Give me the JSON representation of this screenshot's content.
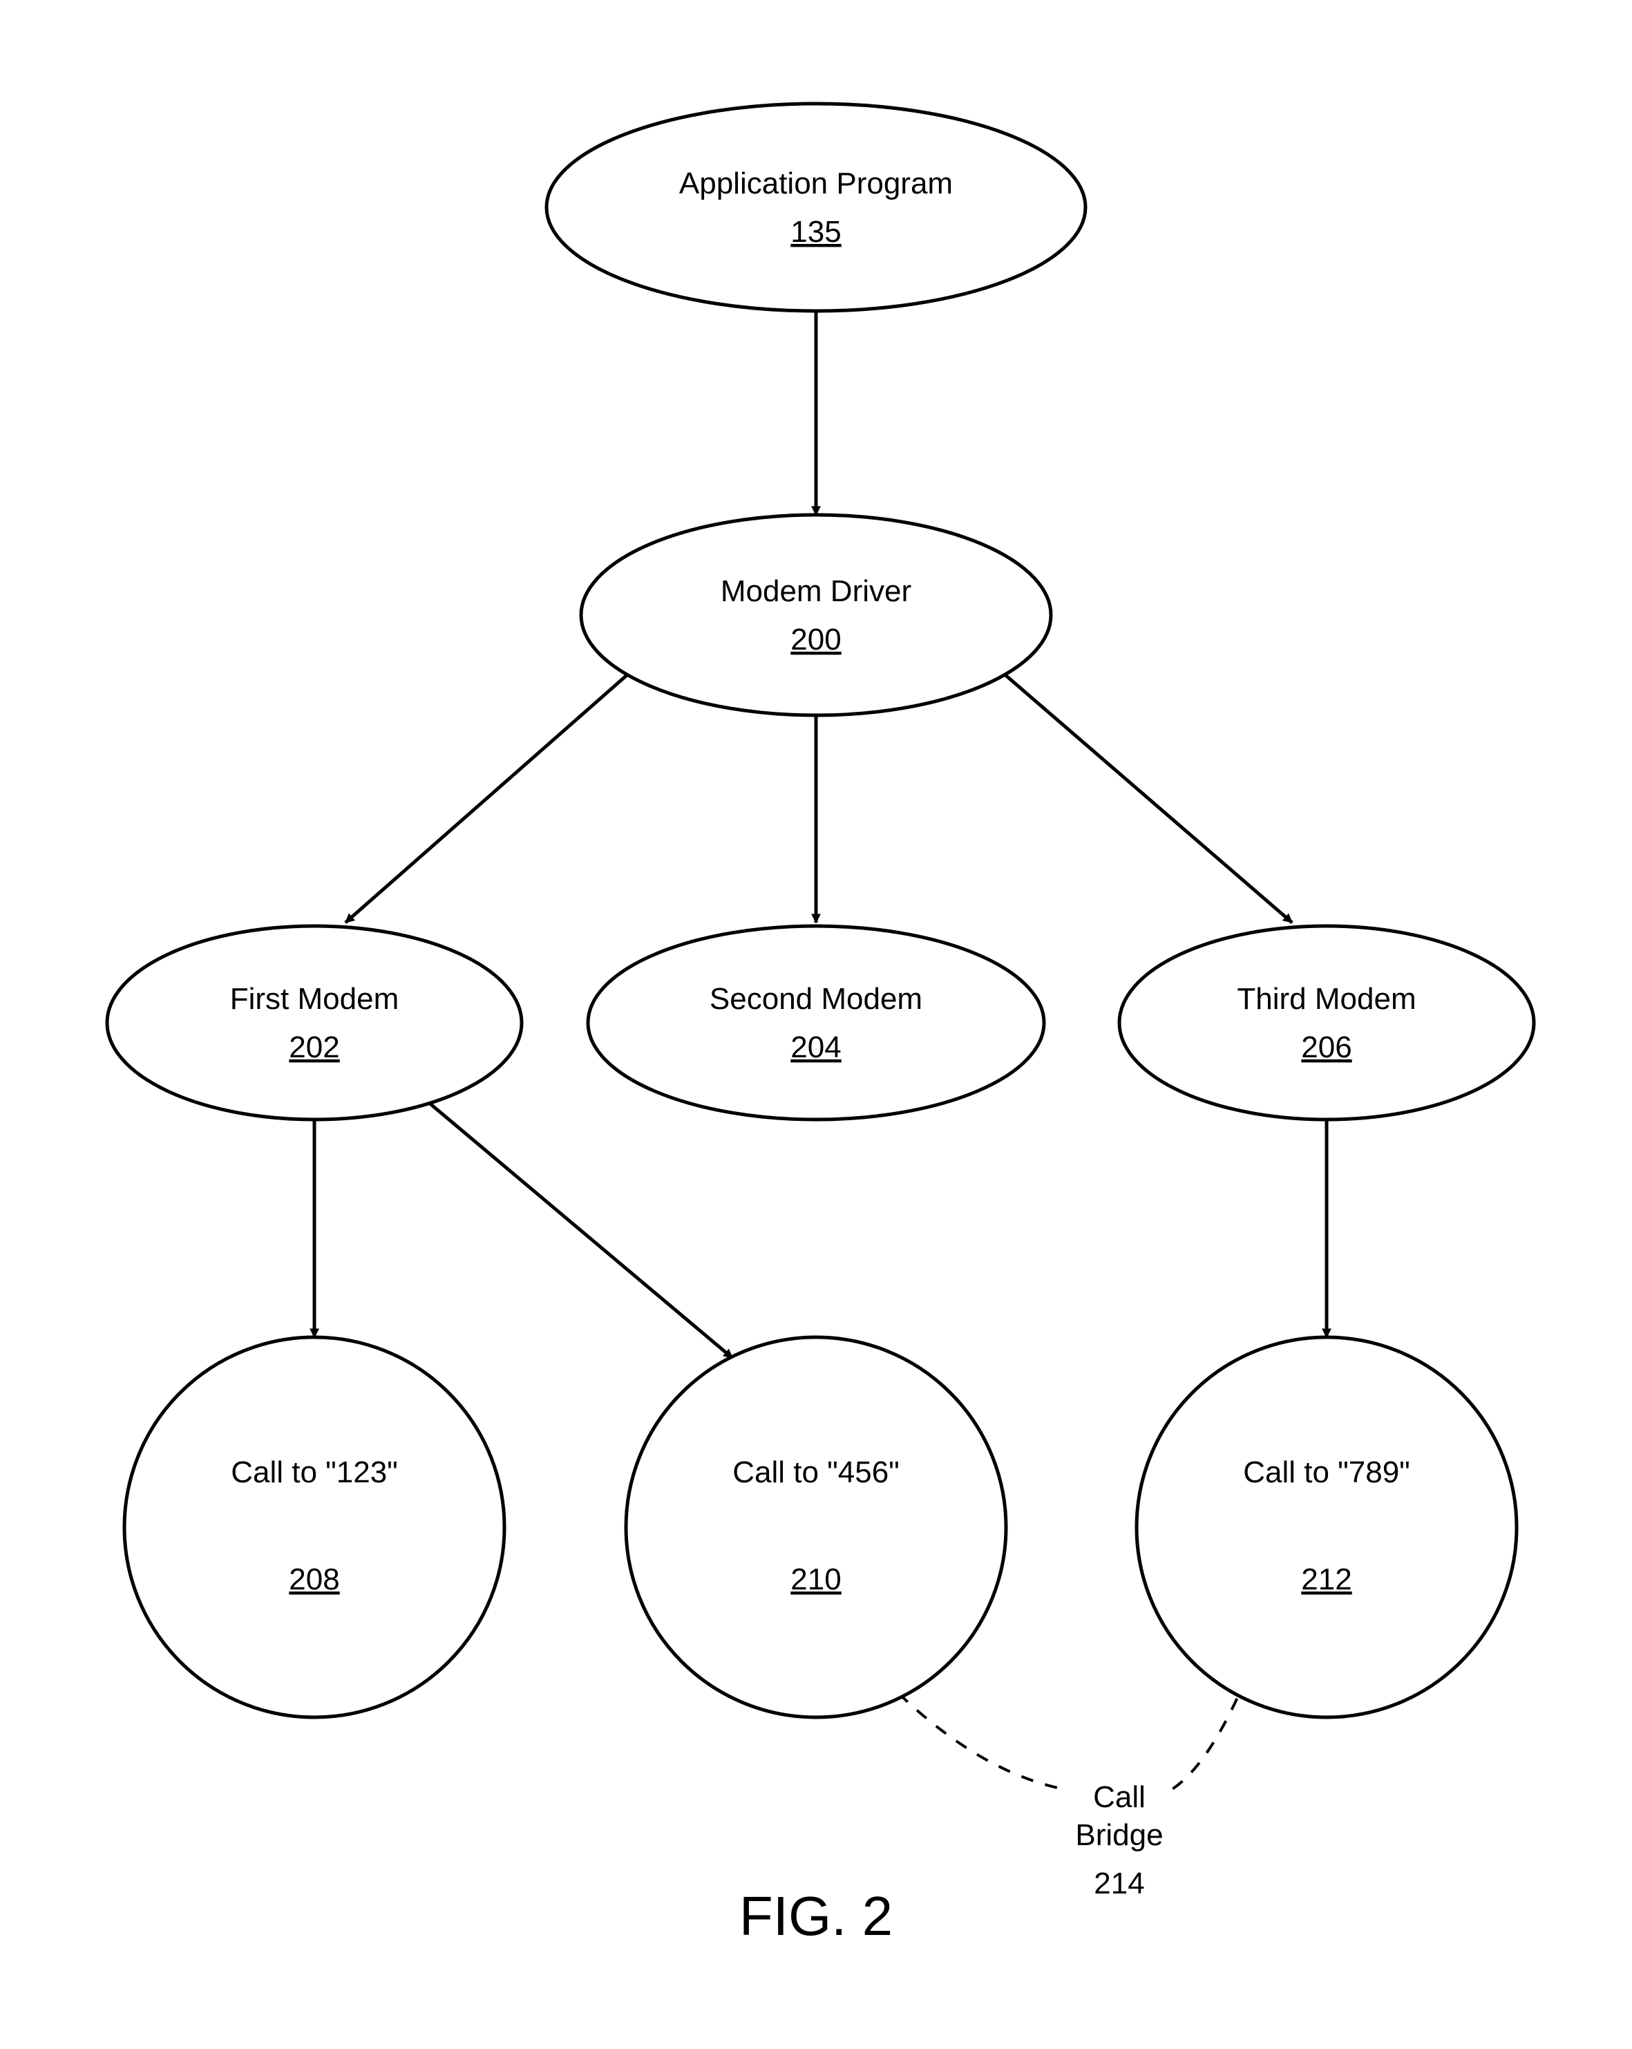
{
  "figure_label": "FIG. 2",
  "nodes": {
    "app": {
      "label": "Application Program",
      "ref": "135"
    },
    "driver": {
      "label": "Modem Driver",
      "ref": "200"
    },
    "modem1": {
      "label": "First Modem",
      "ref": "202"
    },
    "modem2": {
      "label": "Second Modem",
      "ref": "204"
    },
    "modem3": {
      "label": "Third Modem",
      "ref": "206"
    },
    "call123": {
      "label": "Call to \"123\"",
      "ref": "208"
    },
    "call456": {
      "label": "Call to \"456\"",
      "ref": "210"
    },
    "call789": {
      "label": "Call to \"789\"",
      "ref": "212"
    }
  },
  "bridge": {
    "line1": "Call",
    "line2": "Bridge",
    "ref": "214"
  },
  "edges": [
    {
      "from": "app",
      "to": "driver"
    },
    {
      "from": "driver",
      "to": "modem1"
    },
    {
      "from": "driver",
      "to": "modem2"
    },
    {
      "from": "driver",
      "to": "modem3"
    },
    {
      "from": "modem1",
      "to": "call123"
    },
    {
      "from": "modem1",
      "to": "call456"
    },
    {
      "from": "modem3",
      "to": "call789"
    }
  ],
  "bridge_edge": {
    "from": "call456",
    "to": "call789"
  }
}
